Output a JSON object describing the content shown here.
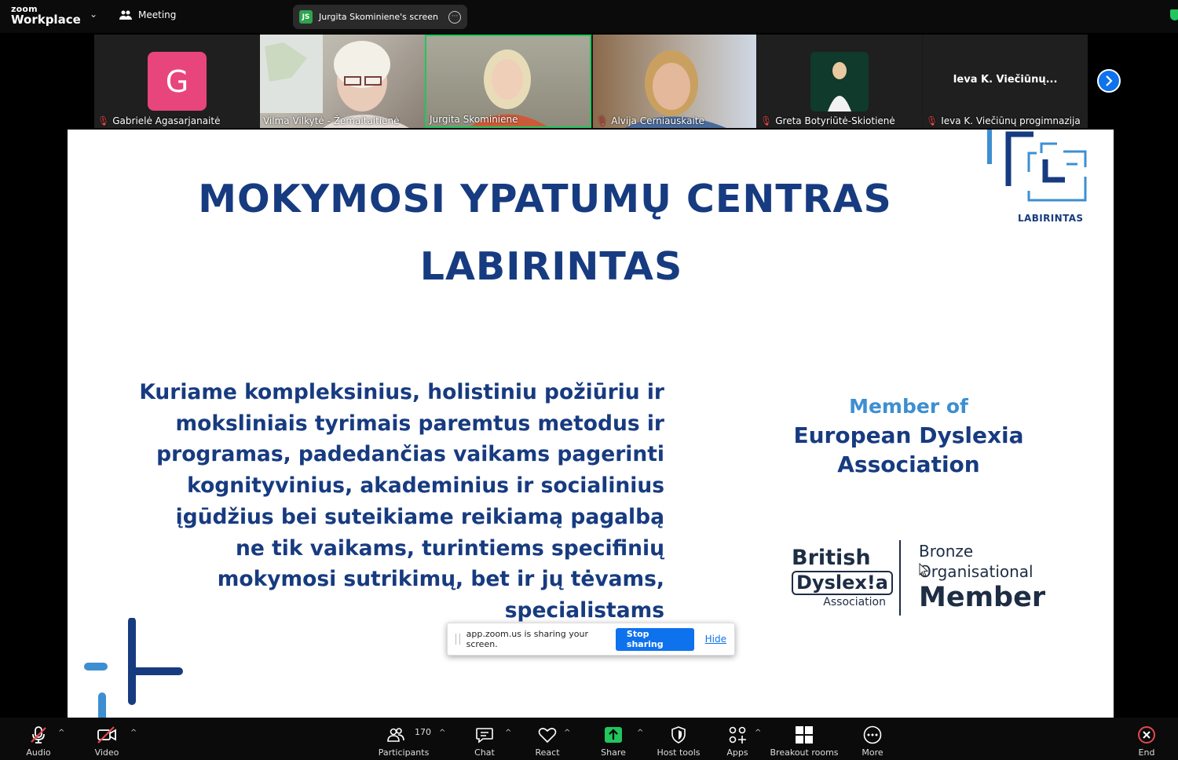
{
  "topbar": {
    "logo_small": "zoom",
    "logo_big": "Workplace",
    "meeting_label": "Meeting",
    "screen_pill": {
      "initials": "JS",
      "label": "Jurgita Skominiene's screen"
    }
  },
  "gallery": {
    "participants": [
      {
        "name": "Gabrielė Agasarjanaitė",
        "avatar_letter": "G",
        "muted": true
      },
      {
        "name": "Vilma Vilkytė - Žemaitaitienė",
        "muted": false
      },
      {
        "name": "Jurgita Skominiene",
        "muted": false,
        "active": true
      },
      {
        "name": "Alvija Cerniauskaite",
        "muted": true
      },
      {
        "name": "Greta Botyriūtė-Skiotienė",
        "muted": true
      },
      {
        "name": "Ieva K. Viečiūnų progimnazija",
        "display_name": "Ieva K. Viečiūnų...",
        "muted": true
      }
    ]
  },
  "slide": {
    "title_line1": "MOKYMOSI YPATUMŲ CENTRAS",
    "title_line2": "LABIRINTAS",
    "logo_caption": "LABIRINTAS",
    "body_lines": [
      "Kuriame kompleksinius, holistiniu požiūriu ir",
      "moksliniais tyrimais paremtus metodus ir",
      "programas, padedančias vaikams pagerinti",
      "kognityvinius, akademinius ir socialinius",
      "įgūdžius bei suteikiame reikiamą pagalbą",
      "ne tik vaikams, turintiems specifinių",
      "mokymosi sutrikimų, bet ir jų tėvams,",
      "specialistams"
    ],
    "member_of": "Member of",
    "eda_line1": "European Dyslexia",
    "eda_line2": "Association",
    "bda_british": "British",
    "bda_dyslexia": "Dyslex!a",
    "bda_association": "Association",
    "bronze_line1": "Bronze",
    "bronze_line2": "Organisational",
    "bronze_line3": "Member"
  },
  "share_banner": {
    "message": "app.zoom.us is sharing your screen.",
    "stop_label": "Stop sharing",
    "hide_label": "Hide"
  },
  "toolbar": {
    "audio": "Audio",
    "video": "Video",
    "participants": "Participants",
    "participant_count": "170",
    "chat": "Chat",
    "react": "React",
    "share": "Share",
    "host_tools": "Host tools",
    "apps": "Apps",
    "breakout_rooms": "Breakout rooms",
    "more": "More",
    "end": "End"
  },
  "colors": {
    "slide_navy": "#173b80",
    "slide_light_blue": "#3d8fd1",
    "zoom_blue": "#0e72ed",
    "active_green": "#22c55e",
    "avatar_pink": "#e8457c",
    "end_red": "#e5484d"
  }
}
